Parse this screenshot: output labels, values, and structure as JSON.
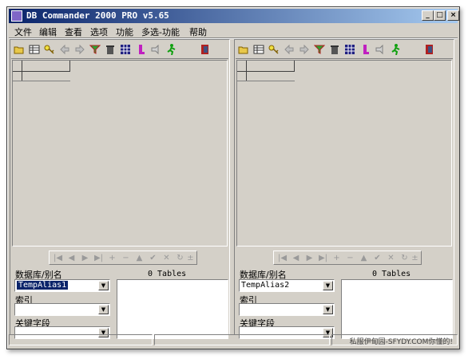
{
  "window": {
    "title": "DB Commander 2000 PRO v5.65",
    "min_label": "_",
    "max_label": "□",
    "close_label": "×"
  },
  "menu": {
    "items": [
      "文件",
      "编辑",
      "查看",
      "选项",
      "功能",
      "多选-功能",
      "帮助"
    ]
  },
  "left_pane": {
    "db_label": "数据库/别名",
    "tables_count": "0 Tables",
    "db_value": "TempAlias1",
    "index_label": "索引",
    "index_value": "",
    "key_label": "关键字段",
    "key_value": ""
  },
  "right_pane": {
    "db_label": "数据库/别名",
    "tables_count": "0 Tables",
    "db_value": "TempAlias2",
    "index_label": "索引",
    "index_value": "",
    "key_label": "关键字段",
    "key_value": ""
  },
  "toolbar_icons": [
    "open-folder-icon",
    "table-icon",
    "key-icon",
    "back-arrow-icon",
    "forward-arrow-icon",
    "filter-icon",
    "trash-icon",
    "grid-icon",
    "sql-icon",
    "query-icon",
    "run-icon",
    "exit-icon"
  ],
  "navigator_glyphs": [
    "|◀",
    "◀",
    "▶",
    "▶|",
    "+",
    "−",
    "▲",
    "✔",
    "✕",
    "↻",
    "±"
  ],
  "status": {
    "watermark": "私服伊甸园-SFYDY.COM你懂的!"
  },
  "colors": {
    "face": "#d4d0c8",
    "title_start": "#0a246a",
    "title_end": "#a6caf0"
  }
}
